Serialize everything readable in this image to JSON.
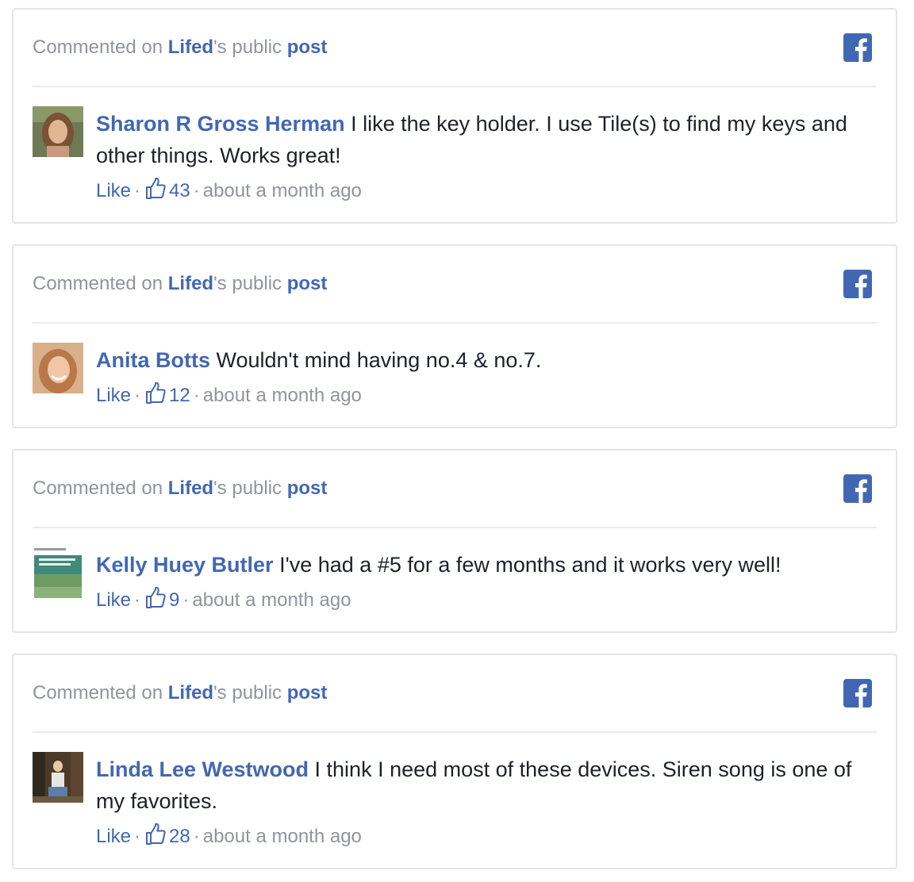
{
  "comments": [
    {
      "header": {
        "prefix": "Commented on ",
        "page": "Lifed",
        "middle": "'s public ",
        "post": "post"
      },
      "author": "Sharon R Gross Herman",
      "text": " I like the key holder. I use Tile(s) to find my keys and other things. Works great!",
      "like_label": "Like",
      "likes": "43",
      "time": "about a month ago"
    },
    {
      "header": {
        "prefix": "Commented on ",
        "page": "Lifed",
        "middle": "'s public ",
        "post": "post"
      },
      "author": "Anita Botts",
      "text": " Wouldn't mind having no.4 & no.7.",
      "like_label": "Like",
      "likes": "12",
      "time": "about a month ago"
    },
    {
      "header": {
        "prefix": "Commented on ",
        "page": "Lifed",
        "middle": "'s public ",
        "post": "post"
      },
      "author": "Kelly Huey Butler",
      "text": " I've had a #5 for a few months and it works very well!",
      "like_label": "Like",
      "likes": "9",
      "time": "about a month ago"
    },
    {
      "header": {
        "prefix": "Commented on ",
        "page": "Lifed",
        "middle": "'s public ",
        "post": "post"
      },
      "author": "Linda Lee Westwood",
      "text": " I think I need most of these devices. Siren song is one of my favorites.",
      "like_label": "Like",
      "likes": "28",
      "time": "about a month ago"
    }
  ],
  "separator": "·",
  "colors": {
    "link": "#4267b2",
    "muted": "#90949c",
    "text": "#1d2129",
    "border": "#e3e5e9"
  },
  "icons": {
    "brand": "facebook-icon",
    "like": "thumbs-up-icon"
  }
}
